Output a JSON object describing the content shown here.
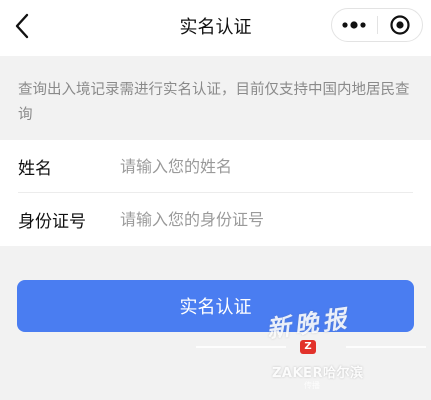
{
  "nav": {
    "title": "实名认证",
    "back_icon": "chevron-left-icon",
    "more_icon": "more-dots-icon",
    "close_icon": "target-circle-icon"
  },
  "notice": {
    "text": "查询出入境记录需进行实名认证，目前仅支持中国内地居民查询"
  },
  "form": {
    "name": {
      "label": "姓名",
      "placeholder": "请输入您的姓名",
      "value": ""
    },
    "id_number": {
      "label": "身份证号",
      "placeholder": "请输入您的身份证号",
      "value": ""
    }
  },
  "submit": {
    "label": "实名认证",
    "color": "#4a7df1"
  },
  "watermark": {
    "brush_text": "新晚报",
    "badge": "Z",
    "brand": "ZAKER哈尔滨",
    "sub": "传播"
  }
}
